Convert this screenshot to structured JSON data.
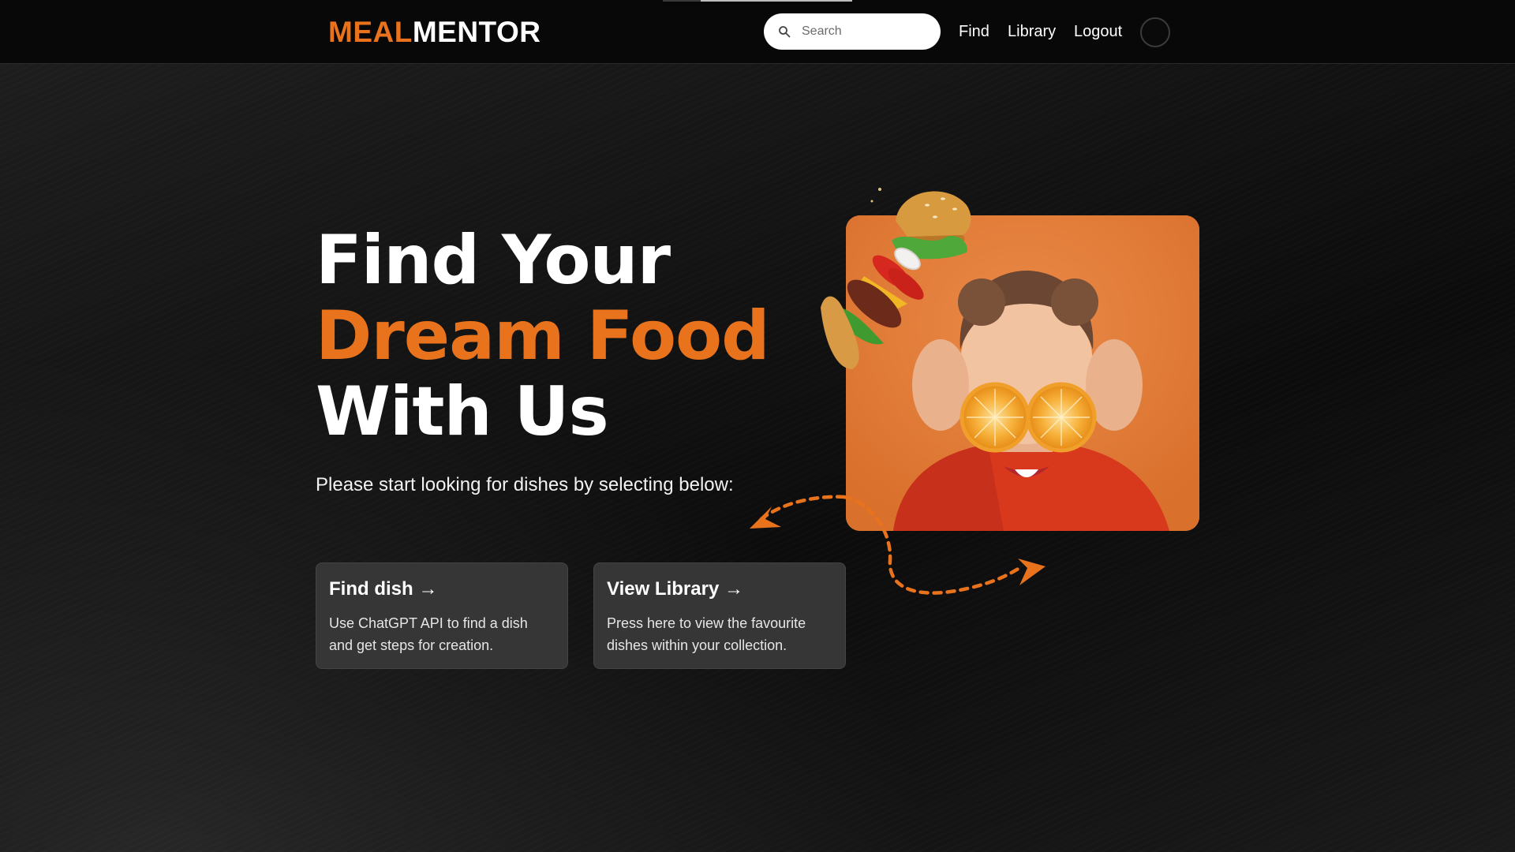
{
  "header": {
    "logo_part1": "MEAL",
    "logo_part2": "MENTOR",
    "search_placeholder": "Search",
    "nav": {
      "find": "Find",
      "library": "Library",
      "logout": "Logout"
    }
  },
  "hero": {
    "title_line1": "Find Your",
    "title_line2": "Dream Food",
    "title_line3": "With Us",
    "subtitle": "Please start looking for dishes by selecting below:"
  },
  "cards": [
    {
      "title": "Find dish →",
      "description": "Use ChatGPT API to find a dish and get steps for creation."
    },
    {
      "title": "View Library →",
      "description": "Press here to view the favourite dishes within your collection."
    }
  ],
  "colors": {
    "accent": "#e8731c",
    "background": "#0d0d0d",
    "card": "#363636",
    "photo_background": "#e07e3a"
  },
  "icons": {
    "search": "search-icon",
    "avatar": "user-avatar",
    "arrows": "dashed-arrow-icon"
  }
}
